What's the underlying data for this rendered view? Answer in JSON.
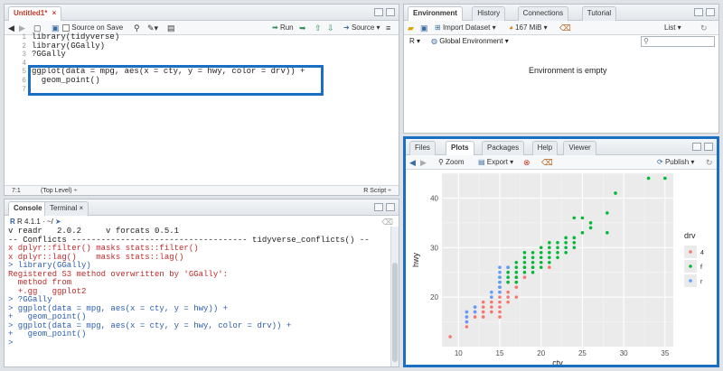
{
  "source": {
    "tab_label": "Untitled1*",
    "source_on_save_label": "Source on Save",
    "run_label": "Run",
    "source_label": "Source",
    "lines": [
      {
        "num": "1",
        "text": "library(tidyverse)"
      },
      {
        "num": "2",
        "text": "library(GGally)"
      },
      {
        "num": "3",
        "text": "?GGally"
      },
      {
        "num": "4",
        "text": ""
      },
      {
        "num": "5",
        "text": "ggplot(data = mpg, aes(x = cty, y = hwy, color = drv)) +"
      },
      {
        "num": "6",
        "text": "  geom_point()"
      },
      {
        "num": "7",
        "text": ""
      }
    ],
    "cursor_pos": "7:1",
    "scope": "(Top Level)",
    "script_type": "R Script"
  },
  "console": {
    "tab_console": "Console",
    "tab_terminal": "Terminal",
    "r_version": "R 4.1.1 · ~/",
    "lines": [
      {
        "text": "v readr   2.0.2     v forcats 0.5.1",
        "style": ""
      },
      {
        "text": "-- Conflicts ------------------------------------ tidyverse_conflicts() --",
        "style": ""
      },
      {
        "text": "x dplyr::filter() masks stats::filter()",
        "style": "red"
      },
      {
        "text": "x dplyr::lag()    masks stats::lag()",
        "style": "red"
      },
      {
        "text": "> library(GGally)",
        "style": "blue"
      },
      {
        "text": "Registered S3 method overwritten by 'GGally':",
        "style": "red"
      },
      {
        "text": "  method from",
        "style": "red"
      },
      {
        "text": "  +.gg   ggplot2",
        "style": "red"
      },
      {
        "text": "> ?GGally",
        "style": "blue"
      },
      {
        "text": "> ggplot(data = mpg, aes(x = cty, y = hwy)) +",
        "style": "blue"
      },
      {
        "text": "+   geom_point()",
        "style": "blue"
      },
      {
        "text": "> ggplot(data = mpg, aes(x = cty, y = hwy, color = drv)) +",
        "style": "blue"
      },
      {
        "text": "+   geom_point()",
        "style": "blue"
      },
      {
        "text": "> ",
        "style": "blue"
      }
    ]
  },
  "environment": {
    "tabs": [
      "Environment",
      "History",
      "Connections",
      "Tutorial"
    ],
    "import_label": "Import Dataset",
    "memory_label": "167 MiB",
    "view_label": "List",
    "r_label": "R",
    "global_env_label": "Global Environment",
    "empty_message": "Environment is empty"
  },
  "files": {
    "tabs": [
      "Files",
      "Plots",
      "Packages",
      "Help",
      "Viewer"
    ],
    "zoom_label": "Zoom",
    "export_label": "Export",
    "publish_label": "Publish"
  },
  "chart_data": {
    "type": "scatter",
    "xlabel": "cty",
    "ylabel": "hwy",
    "xlim": [
      8,
      36
    ],
    "ylim": [
      10,
      45
    ],
    "xticks": [
      "10",
      "15",
      "20",
      "25",
      "30",
      "35"
    ],
    "yticks": [
      "20",
      "30",
      "40"
    ],
    "grid": true,
    "legend": {
      "title": "drv",
      "placement": "right",
      "entries": [
        {
          "label": "4",
          "color": "#f8766d"
        },
        {
          "label": "f",
          "color": "#00ba38"
        },
        {
          "label": "r",
          "color": "#619cff"
        }
      ]
    },
    "series": [
      {
        "name": "4",
        "color": "#f8766d",
        "points": [
          [
            9,
            12
          ],
          [
            11,
            14
          ],
          [
            11,
            15
          ],
          [
            11,
            16
          ],
          [
            11,
            17
          ],
          [
            12,
            16
          ],
          [
            12,
            17
          ],
          [
            12,
            18
          ],
          [
            13,
            16
          ],
          [
            13,
            17
          ],
          [
            13,
            18
          ],
          [
            13,
            19
          ],
          [
            14,
            17
          ],
          [
            14,
            18
          ],
          [
            14,
            19
          ],
          [
            14,
            20
          ],
          [
            15,
            16
          ],
          [
            15,
            17
          ],
          [
            15,
            18
          ],
          [
            15,
            19
          ],
          [
            15,
            20
          ],
          [
            15,
            21
          ],
          [
            16,
            19
          ],
          [
            16,
            20
          ],
          [
            16,
            21
          ],
          [
            17,
            20
          ],
          [
            17,
            22
          ],
          [
            17,
            24
          ],
          [
            18,
            24
          ],
          [
            18,
            26
          ],
          [
            19,
            26
          ],
          [
            20,
            27
          ],
          [
            21,
            26
          ],
          [
            15,
            22
          ],
          [
            16,
            23
          ],
          [
            17,
            23
          ]
        ]
      },
      {
        "name": "f",
        "color": "#00ba38",
        "points": [
          [
            15,
            22
          ],
          [
            15,
            23
          ],
          [
            15,
            24
          ],
          [
            16,
            23
          ],
          [
            16,
            24
          ],
          [
            16,
            25
          ],
          [
            16,
            26
          ],
          [
            17,
            23
          ],
          [
            17,
            24
          ],
          [
            17,
            25
          ],
          [
            17,
            26
          ],
          [
            17,
            27
          ],
          [
            18,
            25
          ],
          [
            18,
            26
          ],
          [
            18,
            27
          ],
          [
            18,
            28
          ],
          [
            18,
            29
          ],
          [
            19,
            25
          ],
          [
            19,
            26
          ],
          [
            19,
            27
          ],
          [
            19,
            28
          ],
          [
            19,
            29
          ],
          [
            20,
            26
          ],
          [
            20,
            27
          ],
          [
            20,
            28
          ],
          [
            20,
            29
          ],
          [
            20,
            30
          ],
          [
            21,
            27
          ],
          [
            21,
            28
          ],
          [
            21,
            29
          ],
          [
            21,
            30
          ],
          [
            21,
            31
          ],
          [
            22,
            28
          ],
          [
            22,
            29
          ],
          [
            22,
            30
          ],
          [
            22,
            31
          ],
          [
            23,
            29
          ],
          [
            23,
            30
          ],
          [
            23,
            31
          ],
          [
            23,
            32
          ],
          [
            24,
            30
          ],
          [
            24,
            31
          ],
          [
            24,
            32
          ],
          [
            24,
            36
          ],
          [
            25,
            33
          ],
          [
            25,
            36
          ],
          [
            26,
            35
          ],
          [
            26,
            34
          ],
          [
            28,
            33
          ],
          [
            28,
            37
          ],
          [
            29,
            41
          ],
          [
            33,
            44
          ],
          [
            35,
            44
          ]
        ]
      },
      {
        "name": "r",
        "color": "#619cff",
        "points": [
          [
            11,
            15
          ],
          [
            11,
            16
          ],
          [
            11,
            17
          ],
          [
            12,
            17
          ],
          [
            12,
            18
          ],
          [
            14,
            20
          ],
          [
            14,
            21
          ],
          [
            15,
            21
          ],
          [
            15,
            22
          ],
          [
            15,
            23
          ],
          [
            15,
            24
          ],
          [
            15,
            25
          ],
          [
            15,
            26
          ],
          [
            16,
            26
          ]
        ]
      }
    ]
  }
}
